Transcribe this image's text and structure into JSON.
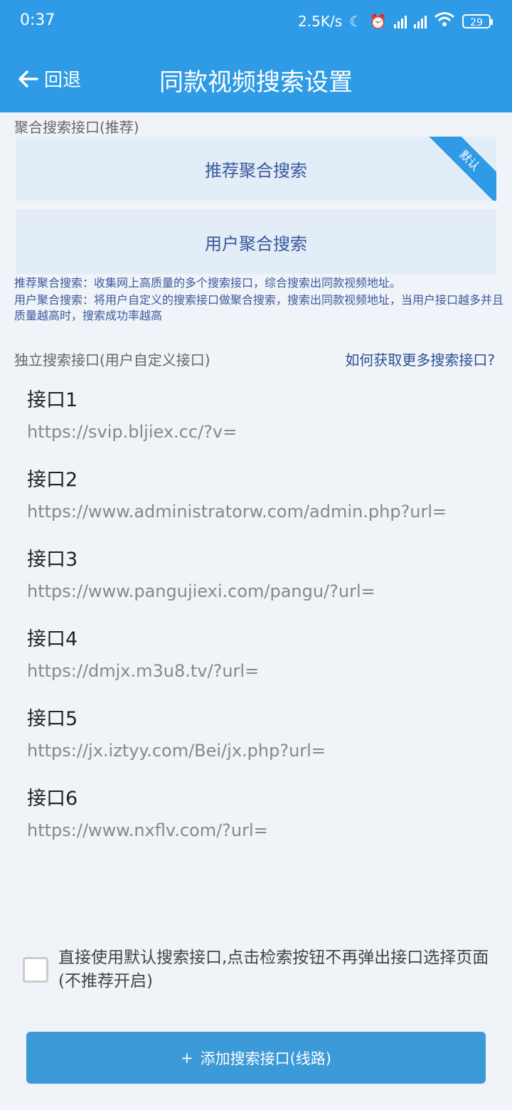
{
  "status": {
    "time": "0:37",
    "speed": "2.5K/s",
    "battery": "29",
    "icons": [
      "moon-icon",
      "alarm-icon",
      "signal-hd-icon",
      "signal-hd-icon",
      "wifi-icon",
      "battery-icon"
    ]
  },
  "nav": {
    "back_label": "回退",
    "title": "同款视频搜索设置"
  },
  "aggregate": {
    "section_label": "聚合搜索接口(推荐)",
    "cards": [
      {
        "label": "推荐聚合搜索",
        "badge": "默认"
      },
      {
        "label": "用户聚合搜索"
      }
    ],
    "desc_line1": "推荐聚合搜索：收集网上高质量的多个搜索接口，综合搜索出同款视频地址。",
    "desc_line2": "用户聚合搜索：将用户自定义的搜索接口做聚合搜索，搜索出同款视频地址，当用户接口越多并且质量越高时，搜索成功率越高"
  },
  "custom": {
    "section_label": "独立搜索接口(用户自定义接口)",
    "help_link": "如何获取更多搜索接口?",
    "items": [
      {
        "name": "接口1",
        "url": "https://svip.bljiex.cc/?v="
      },
      {
        "name": "接口2",
        "url": "https://www.administratorw.com/admin.php?url="
      },
      {
        "name": "接口3",
        "url": "https://www.pangujiexi.com/pangu/?url="
      },
      {
        "name": "接口4",
        "url": "https://dmjx.m3u8.tv/?url="
      },
      {
        "name": "接口5",
        "url": "https://jx.iztyy.com/Bei/jx.php?url="
      },
      {
        "name": "接口6",
        "url": "https://www.nxflv.com/?url="
      }
    ]
  },
  "checkbox": {
    "checked": false,
    "label": "直接使用默认搜索接口,点击检索按钮不再弹出接口选择页面(不推荐开启)"
  },
  "add_button": {
    "icon": "+",
    "label": "添加搜索接口(线路)"
  },
  "colors": {
    "header": "#2f9ae6",
    "background": "#f0f3f8",
    "card": "#e3edf7",
    "accent_text": "#3a5a9c",
    "button": "#3c9ad8"
  }
}
